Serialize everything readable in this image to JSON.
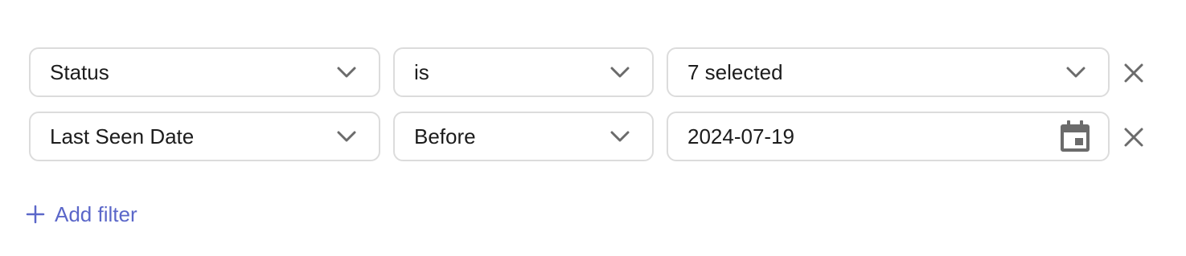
{
  "filters": [
    {
      "attribute": "Status",
      "operator": "is",
      "value": "7 selected",
      "value_type": "multi-select",
      "icons": {
        "attribute": "chevron-down-icon",
        "operator": "chevron-down-icon",
        "value": "chevron-down-icon",
        "remove": "close-icon"
      }
    },
    {
      "attribute": "Last Seen Date",
      "operator": "Before",
      "value": "2024-07-19",
      "value_type": "date",
      "icons": {
        "attribute": "chevron-down-icon",
        "operator": "chevron-down-icon",
        "value": "calendar-icon",
        "remove": "close-icon"
      }
    }
  ],
  "add_filter": {
    "label": "Add filter",
    "icon": "plus-icon"
  },
  "colors": {
    "accent": "#5b67c9",
    "border": "#dcdcdc",
    "icon": "#6b6b6b",
    "text": "#1c1c1c"
  }
}
